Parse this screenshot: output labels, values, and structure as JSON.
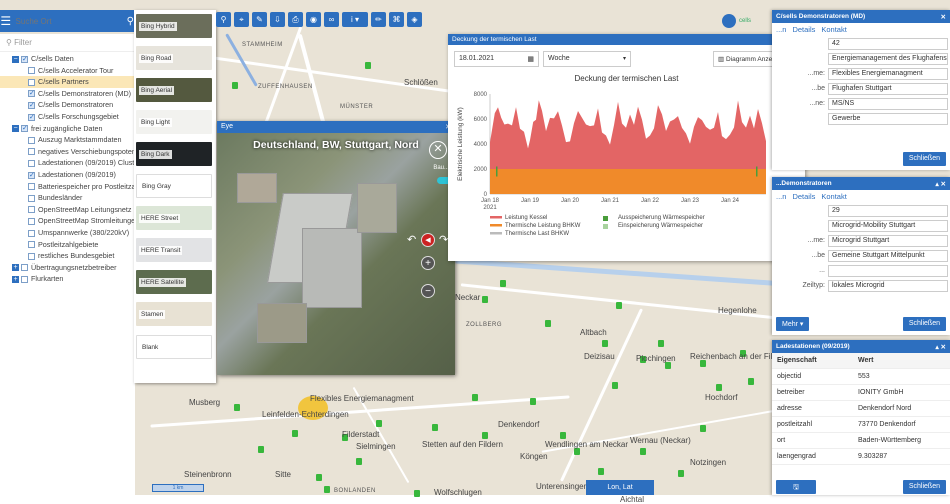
{
  "search": {
    "placeholder": "Suche Ort"
  },
  "filter": {
    "placeholder": "Filter"
  },
  "tree": [
    {
      "label": "C/sells Daten",
      "level": 0,
      "exp": "−",
      "cb": "on"
    },
    {
      "label": "C/sells Accelerator Tour",
      "level": 1,
      "cb": "off"
    },
    {
      "label": "C/sells Partners",
      "level": 1,
      "cb": "off",
      "hl": true
    },
    {
      "label": "C/sells Demonstratoren (MD)",
      "level": 1,
      "cb": "on"
    },
    {
      "label": "C/sells Demonstratoren",
      "level": 1,
      "cb": "on"
    },
    {
      "label": "C/sells Forschungsgebiet",
      "level": 1,
      "cb": "on"
    },
    {
      "label": "frei zugängliche Daten",
      "level": 0,
      "exp": "−",
      "cb": "on"
    },
    {
      "label": "Auszug Marktstammdaten",
      "level": 1,
      "cb": "off"
    },
    {
      "label": "negatives Verschiebungspotential",
      "level": 1,
      "cb": "off"
    },
    {
      "label": "Ladestationen (09/2019) Cluster",
      "level": 1,
      "cb": "off"
    },
    {
      "label": "Ladestationen (09/2019)",
      "level": 1,
      "cb": "on"
    },
    {
      "label": "Batteriespeicher pro Postleitzahl",
      "level": 1,
      "cb": "off"
    },
    {
      "label": "Bundesländer",
      "level": 1,
      "cb": "off"
    },
    {
      "label": "OpenStreetMap Leitungsnetz",
      "level": 1,
      "cb": "off"
    },
    {
      "label": "OpenStreetMap Stromleitungen",
      "level": 1,
      "cb": "off"
    },
    {
      "label": "Umspannwerke (380/220kV)",
      "level": 1,
      "cb": "off"
    },
    {
      "label": "Postleitzahlgebiete",
      "level": 1,
      "cb": "off"
    },
    {
      "label": "restliches Bundesgebiet",
      "level": 1,
      "cb": "off"
    },
    {
      "label": "Übertragungsnetzbetreiber",
      "level": 0,
      "exp": "+",
      "cb": "off"
    },
    {
      "label": "Flurkarten",
      "level": 0,
      "exp": "+",
      "cb": "off"
    }
  ],
  "basemaps": [
    {
      "label": "Bing Hybrid",
      "color": "#6b6e5b"
    },
    {
      "label": "Bing Road",
      "color": "#e7e4dc"
    },
    {
      "label": "Bing Aerial",
      "color": "#54593f"
    },
    {
      "label": "Bing Light",
      "color": "#f2f2ef"
    },
    {
      "label": "Bing Dark",
      "color": "#1f2326"
    },
    {
      "label": "Bing Gray",
      "color": "#ffffff"
    },
    {
      "label": "HERE Street",
      "color": "#dce6d7"
    },
    {
      "label": "HERE Transit",
      "color": "#e2e3e5"
    },
    {
      "label": "HERE Satellite",
      "color": "#5d6c4e"
    },
    {
      "label": "Stamen",
      "color": "#e8e2d4"
    },
    {
      "label": "Blank",
      "color": "#ffffff"
    }
  ],
  "map_labels": [
    {
      "t": "STAMMHEIM",
      "c": "maplbl"
    },
    {
      "t": "Schlößen",
      "c": "maplbl big"
    },
    {
      "t": "ZUFFENHAUSEN",
      "c": "maplbl"
    },
    {
      "t": "MÜNSTER",
      "c": "maplbl"
    },
    {
      "t": "Neckar",
      "c": "maplbl big"
    },
    {
      "t": "ZOLLBERG",
      "c": "maplbl"
    },
    {
      "t": "Altbach",
      "c": "maplbl big"
    },
    {
      "t": "Deizisau",
      "c": "maplbl big"
    },
    {
      "t": "Plochingen",
      "c": "maplbl big"
    },
    {
      "t": "Reichenbach an der Fils",
      "c": "maplbl big"
    },
    {
      "t": "Hegenlohe",
      "c": "maplbl big"
    },
    {
      "t": "Musberg",
      "c": "maplbl big"
    },
    {
      "t": "Flexibles Energiemanagment",
      "c": "maplbl big"
    },
    {
      "t": "Leinfelden-Echterdingen",
      "c": "maplbl big"
    },
    {
      "t": "Denkendorf",
      "c": "maplbl big"
    },
    {
      "t": "Hochdorf",
      "c": "maplbl big"
    },
    {
      "t": "Köngen",
      "c": "maplbl big"
    },
    {
      "t": "Wernau (Neckar)",
      "c": "maplbl big"
    },
    {
      "t": "Filderstadt",
      "c": "maplbl big"
    },
    {
      "t": "Wendlingen am Neckar",
      "c": "maplbl big"
    },
    {
      "t": "Sielmingen",
      "c": "maplbl big"
    },
    {
      "t": "Notzingen",
      "c": "maplbl big"
    },
    {
      "t": "Steinenbronn",
      "c": "maplbl big"
    },
    {
      "t": "Unterensingen",
      "c": "maplbl big"
    },
    {
      "t": "Wolfschlugen",
      "c": "maplbl big"
    },
    {
      "t": "Aichtal",
      "c": "maplbl big"
    },
    {
      "t": "BONLANDEN",
      "c": "maplbl"
    },
    {
      "t": "Sitte",
      "c": "maplbl big"
    },
    {
      "t": "Stetten auf den Fildern",
      "c": "maplbl big"
    }
  ],
  "eye": {
    "header": "Eye",
    "title": "Deutschland, BW, Stuttgart, Nord",
    "toggle": "Bau..."
  },
  "chart_window": {
    "header": "Deckung der termischen Last",
    "date": "18.01.2021",
    "period": "Woche",
    "button": "Diagramm Anzeigen"
  },
  "chart_data": {
    "type": "area",
    "title": "Deckung der termischen  Last",
    "ylabel": "Elektrische Leistung (kW)",
    "ylim": [
      0,
      8000
    ],
    "yticks": [
      "0",
      "2000",
      "4000",
      "6000",
      "8000"
    ],
    "xticks": [
      "Jan 18\n2021",
      "Jan 19",
      "Jan 20",
      "Jan 21",
      "Jan 22",
      "Jan 23",
      "Jan 24"
    ],
    "x_range_days": [
      0,
      6.9
    ],
    "series": [
      {
        "name": "Leistung Kessel",
        "color": "#e36565"
      },
      {
        "name": "Thermische Leistung BHKW",
        "color": "#f08a2a",
        "constant": 2000
      },
      {
        "name": "Thermische Last BHKW",
        "color": "#bbbbbb"
      },
      {
        "name": "Ausspeicherung Wärmespeicher",
        "color": "#4a9d3b"
      },
      {
        "name": "Einspeicherung Wärmespeicher",
        "color": "#a8d29e"
      }
    ],
    "total_daily_profile": [
      [
        0.0,
        4600
      ],
      [
        0.06,
        5400
      ],
      [
        0.12,
        6200
      ],
      [
        0.2,
        7300
      ],
      [
        0.28,
        6100
      ],
      [
        0.36,
        5200
      ],
      [
        0.45,
        5900
      ],
      [
        0.55,
        5400
      ],
      [
        0.65,
        6500
      ],
      [
        0.75,
        5400
      ],
      [
        0.85,
        4800
      ],
      [
        0.95,
        4100
      ],
      [
        1.0,
        4400
      ],
      [
        1.08,
        5500
      ],
      [
        1.15,
        6300
      ],
      [
        1.22,
        7500
      ],
      [
        1.3,
        6300
      ],
      [
        1.4,
        5300
      ],
      [
        1.5,
        6000
      ],
      [
        1.6,
        5600
      ],
      [
        1.7,
        6800
      ],
      [
        1.8,
        5300
      ],
      [
        1.9,
        4600
      ],
      [
        2.0,
        4300
      ],
      [
        2.1,
        5400
      ],
      [
        2.2,
        7000
      ],
      [
        2.3,
        6100
      ],
      [
        2.4,
        5200
      ],
      [
        2.5,
        5700
      ],
      [
        2.6,
        5400
      ],
      [
        2.7,
        6400
      ],
      [
        2.8,
        5100
      ],
      [
        2.9,
        4500
      ],
      [
        3.0,
        4400
      ],
      [
        3.1,
        5600
      ],
      [
        3.2,
        7100
      ],
      [
        3.3,
        6000
      ],
      [
        3.4,
        5300
      ],
      [
        3.5,
        6000
      ],
      [
        3.6,
        5800
      ],
      [
        3.7,
        6900
      ],
      [
        3.8,
        5500
      ],
      [
        3.9,
        4600
      ],
      [
        4.0,
        4500
      ],
      [
        4.1,
        5700
      ],
      [
        4.2,
        7200
      ],
      [
        4.3,
        6100
      ],
      [
        4.4,
        5400
      ],
      [
        4.5,
        5800
      ],
      [
        4.6,
        5600
      ],
      [
        4.7,
        6500
      ],
      [
        4.8,
        5200
      ],
      [
        4.9,
        4400
      ],
      [
        5.0,
        4200
      ],
      [
        5.1,
        5200
      ],
      [
        5.2,
        6600
      ],
      [
        5.3,
        6000
      ],
      [
        5.4,
        5100
      ],
      [
        5.5,
        5500
      ],
      [
        5.6,
        5300
      ],
      [
        5.7,
        6200
      ],
      [
        5.8,
        4900
      ],
      [
        5.9,
        4300
      ],
      [
        6.0,
        4300
      ],
      [
        6.1,
        5500
      ],
      [
        6.2,
        7300
      ],
      [
        6.3,
        6200
      ],
      [
        6.4,
        5400
      ],
      [
        6.5,
        6000
      ],
      [
        6.6,
        5600
      ],
      [
        6.7,
        6800
      ],
      [
        6.8,
        5300
      ],
      [
        6.9,
        4500
      ]
    ]
  },
  "panel_md": {
    "header": "C/sells Demonstratoren (MD)",
    "tabs": [
      "...n",
      "Details",
      "Kontakt"
    ],
    "fields": [
      {
        "l": "",
        "v": "42"
      },
      {
        "l": "",
        "v": "Energiemanagement des Flughafens"
      },
      {
        "l": "...me:",
        "v": "Flexibles Energiemanagment"
      },
      {
        "l": "...be",
        "v": "Flughafen Stuttgart"
      },
      {
        "l": "...ne:",
        "v": "MS/NS"
      },
      {
        "l": "",
        "v": "Gewerbe"
      }
    ],
    "close": "Schließen"
  },
  "panel_demo": {
    "header": "...Demonstratoren",
    "tabs": [
      "...n",
      "Details",
      "Kontakt"
    ],
    "fields": [
      {
        "l": "",
        "v": "29"
      },
      {
        "l": "",
        "v": "Microgrid-Mobility Stuttgart"
      },
      {
        "l": "...me:",
        "v": "Microgrid Stuttgart"
      },
      {
        "l": "...be",
        "v": "Gemeine Stuttgart Mittelpunkt"
      },
      {
        "l": "...",
        "v": ""
      },
      {
        "l": "Zeiltyp:",
        "v": "lokales Microgrid"
      }
    ],
    "more": "Mehr ▾",
    "close": "Schließen"
  },
  "panel_lad": {
    "header": "Ladestationen (09/2019)",
    "head_k": "Eigenschaft",
    "head_v": "Wert",
    "rows": [
      {
        "k": "objectid",
        "v": "553"
      },
      {
        "k": "betreiber",
        "v": "IONITY GmbH"
      },
      {
        "k": "adresse",
        "v": "Denkendorf Nord"
      },
      {
        "k": "postleitzahl",
        "v": "73770 Denkendorf"
      },
      {
        "k": "ort",
        "v": "Baden-Württemberg"
      },
      {
        "k": "laengengrad",
        "v": "9.303287"
      }
    ],
    "close": "Schließen"
  },
  "coord": "Lon, Lat",
  "scale": "1 km",
  "logo": "cells"
}
